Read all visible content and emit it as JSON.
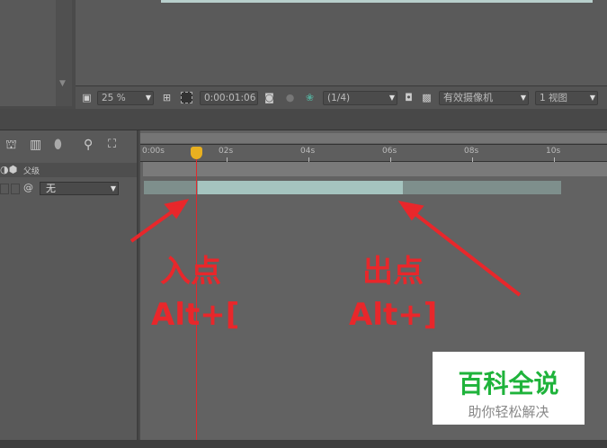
{
  "toolbar": {
    "zoom": "25 %",
    "timecode": "0:00:01:06",
    "resolution": "(1/4)",
    "camera": "有效摄像机",
    "views": "1 视图"
  },
  "timeline": {
    "ticks": [
      "0:00s",
      "02s",
      "04s",
      "06s",
      "08s",
      "10s"
    ],
    "parent_label": "父级",
    "parent_value": "无"
  },
  "annotations": {
    "in_point": "入点",
    "in_shortcut": "Alt+[",
    "out_point": "出点",
    "out_shortcut": "Alt+]"
  },
  "watermark": {
    "title": "百科全说",
    "subtitle": "助你轻松解决"
  },
  "colors": {
    "playhead": "#e0292c",
    "annotation": "#e8272b",
    "logo": "#1fb33b"
  }
}
